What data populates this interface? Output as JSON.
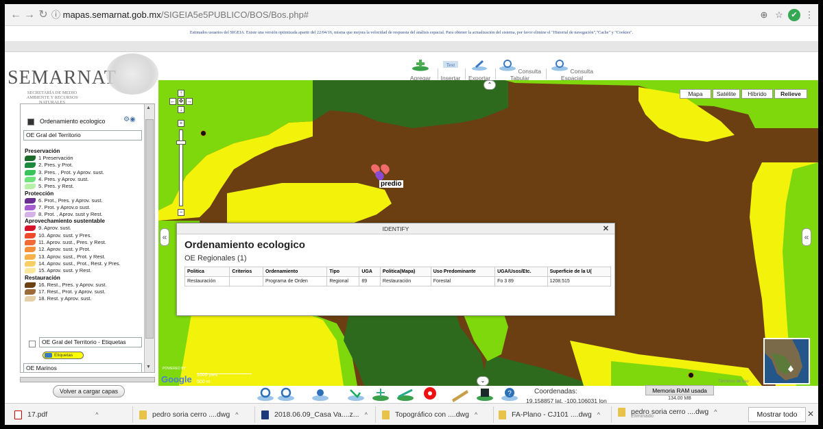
{
  "browser": {
    "url_domain": "mapas.semarnat.gob.mx",
    "url_path": "/SIGEIA5e5PUBLICO/BOS/Bos.php#",
    "notice": "Estimados usuarios del SIGEIA. Existe una versión optimizada apartir del 22/04/16, misma que mejora la velocidad de respuesta del análisis espacial. Para obtener la actualización del sistema, por favor elimine el \"Historial de navegación\",\"Cache\" y \"Cookies\"."
  },
  "header": {
    "brand": "SEMARNAT",
    "subtitle": "SECRETARÍA DE MEDIO AMBIENTE Y RECURSOS NATURALES"
  },
  "toolbar": [
    {
      "label": "Agregar",
      "icon": "add-layer-icon"
    },
    {
      "label": "Insertar",
      "icon": "insert-text-icon"
    },
    {
      "label": "Exportar",
      "icon": "export-icon"
    },
    {
      "label": "Consulta Tabular",
      "icon": "tabular-query-icon"
    },
    {
      "label": "Consulta Espacial",
      "icon": "spatial-query-icon"
    }
  ],
  "sidebar": {
    "layer_title": "Ordenamiento ecologico",
    "layer_select": "OE Gral del Territorio",
    "legend": [
      {
        "group": "Preservación",
        "items": [
          {
            "label": "1 Preservación",
            "color": "#1d6b2a"
          },
          {
            "label": "2. Pres. y Prot.",
            "color": "#1c8a3c"
          },
          {
            "label": "3. Pres. , Prot. y Aprov. sust.",
            "color": "#38c45a"
          },
          {
            "label": "4. Pres. y Aprov. sust.",
            "color": "#6ee37a"
          },
          {
            "label": "5. Pres. y Rest.",
            "color": "#b7f0a8"
          }
        ]
      },
      {
        "group": "Protección",
        "items": [
          {
            "label": "6. Prot., Pres. y Aprov. sust.",
            "color": "#6a2d91"
          },
          {
            "label": "7. Prot. y Aprov.o sust.",
            "color": "#a65ed1"
          },
          {
            "label": "8. Prot. , Aprov. sust y Rest.",
            "color": "#d4b4e6"
          }
        ]
      },
      {
        "group": "Aprovechamiento sustentable",
        "items": [
          {
            "label": "9. Aprov. sust.",
            "color": "#d6122a"
          },
          {
            "label": "10. Aprov. sust. y Pres.",
            "color": "#ee4b2b"
          },
          {
            "label": "11. Aprov. sust., Pres. y Rest.",
            "color": "#f26a35"
          },
          {
            "label": "12. Aprov. sust. y Prot.",
            "color": "#f58f3c"
          },
          {
            "label": "13. Aprov. sust., Prot. y Rest.",
            "color": "#f7b04a"
          },
          {
            "label": "14. Aprov. sust., Prot., Rest. y Pres.",
            "color": "#f8cf67"
          },
          {
            "label": "15. Aprov. sust. y Rest.",
            "color": "#fbe79a"
          }
        ]
      },
      {
        "group": "Restauración",
        "items": [
          {
            "label": "16. Rest., Pres. y Aprov. sust.",
            "color": "#6b4214"
          },
          {
            "label": "17. Rest., Prot. y Aprov. sust.",
            "color": "#9b6b3a"
          },
          {
            "label": "18. Rest. y Aprov. sust.",
            "color": "#e4cfa6"
          }
        ]
      }
    ],
    "labels_layer": "OE Gral del Territorio - Etiquetas",
    "labels_chip": "Etiquetas",
    "marinos_layer": "OE Marinos",
    "reload_button": "Volver a cargar capas"
  },
  "map": {
    "types": [
      "Mapa",
      "Satélite",
      "Híbrido",
      "Relieve"
    ],
    "marker_label": "predio",
    "scale_ft": "1000 pies",
    "scale_m": "500 m",
    "google": "Google",
    "powered": "POWERED BY",
    "terms": "Términos de uso"
  },
  "identify": {
    "header": "IDENTIFY",
    "title": "Ordenamiento ecologico",
    "subtitle": "OE Regionales (1)",
    "columns": [
      "Politica",
      "Criterios",
      "Ordenamiento",
      "Tipo",
      "UGA",
      "Politica(Mapa)",
      "Uso Predominante",
      "UGA/Usos/Etc.",
      "Superficie de la U("
    ],
    "rows": [
      [
        "Restauración",
        "",
        "Programa de Orden",
        "Regional",
        "89",
        "Restauración",
        "Forestal",
        "Fo 3 89",
        "1208.515"
      ]
    ]
  },
  "status": {
    "coords_label": "Coordenadas:",
    "coords_value": "19.158857 lat, -100.106031 lon",
    "ram_label": "Memoria RAM usada",
    "ram_value": "134.00 MB"
  },
  "downloads": [
    {
      "name": "17.pdf",
      "type": "pdf"
    },
    {
      "name": "pedro soria cerro ....dwg",
      "type": "dwg"
    },
    {
      "name": "2018.06.09_Casa Va....z...",
      "type": "kmz"
    },
    {
      "name": "Topográfico con ....dwg",
      "type": "dwg"
    },
    {
      "name": "FA-Plano - CJ101 ....dwg",
      "type": "dwg"
    },
    {
      "name": "pedro soria cerro ....dwg",
      "type": "dwg",
      "status": "Eliminado"
    }
  ],
  "download_bar": {
    "show_all": "Mostrar todo"
  },
  "colors": {
    "brown": "#6b3f12",
    "yellow": "#f2f20a",
    "light_green": "#7ed80c",
    "dark_green": "#2d6a1e"
  }
}
